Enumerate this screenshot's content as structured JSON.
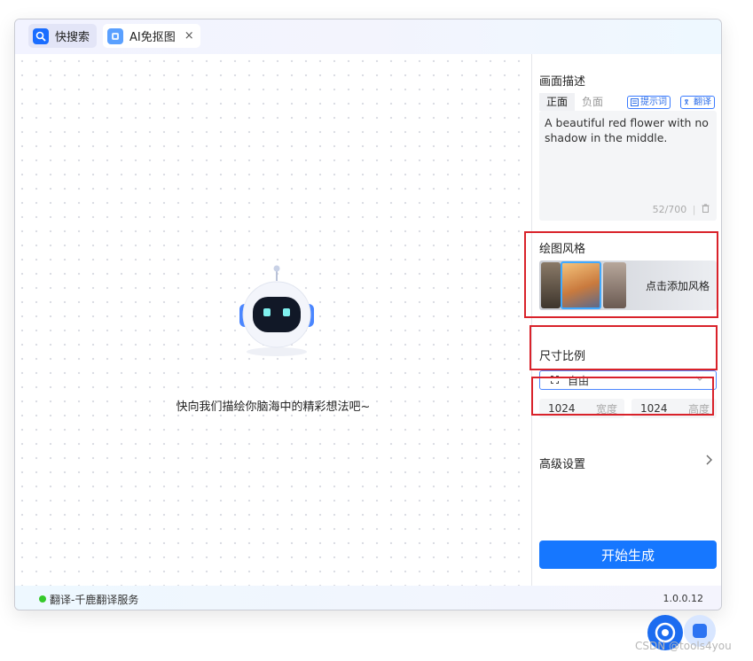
{
  "tabs": [
    {
      "label": "快搜索",
      "icon": "search-icon"
    },
    {
      "label": "AI免抠图",
      "icon": "cutout-app-icon",
      "close": "×"
    }
  ],
  "canvas": {
    "hint": "快向我们描绘你脑海中的精彩想法吧~"
  },
  "panel": {
    "description_title": "画面描述",
    "prompt_tabs": [
      "正面",
      "负面"
    ],
    "prompt_button": "提示词",
    "translate_button": "翻译",
    "prompt_text": "A beautiful red flower with no shadow in the middle.",
    "char_count": "52/700",
    "style_title": "绘图风格",
    "style_add_label": "点击添加风格",
    "ratio_title": "尺寸比例",
    "ratio_value": "自由",
    "width_value": "1024",
    "width_label": "宽度",
    "height_value": "1024",
    "height_label": "高度",
    "advanced_label": "高级设置",
    "generate_label": "开始生成"
  },
  "status": {
    "service": "翻译-千鹿翻译服务",
    "version": "1.0.0.12"
  },
  "watermark": "CSDN @tools4you",
  "colors": {
    "accent": "#1677ff",
    "highlight": "#d9222a",
    "status_ok": "#35c92a"
  }
}
